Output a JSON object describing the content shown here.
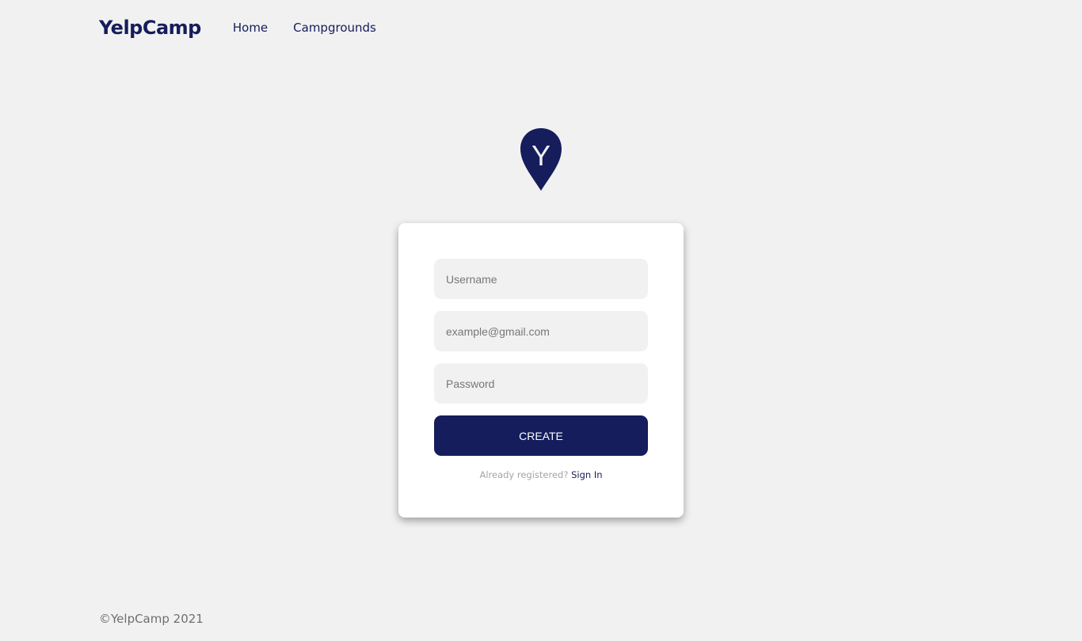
{
  "navbar": {
    "brand": "YelpCamp",
    "links": [
      "Home",
      "Campgrounds"
    ]
  },
  "logo": {
    "icon": "location-pin-icon",
    "letter": "Y",
    "color": "#151d5c"
  },
  "form": {
    "username_placeholder": "Username",
    "email_placeholder": "example@gmail.com",
    "password_placeholder": "Password",
    "submit_label": "CREATE",
    "signin_prompt": "Already registered?",
    "signin_link": "Sign In"
  },
  "footer": {
    "text": "©YelpCamp 2021"
  }
}
